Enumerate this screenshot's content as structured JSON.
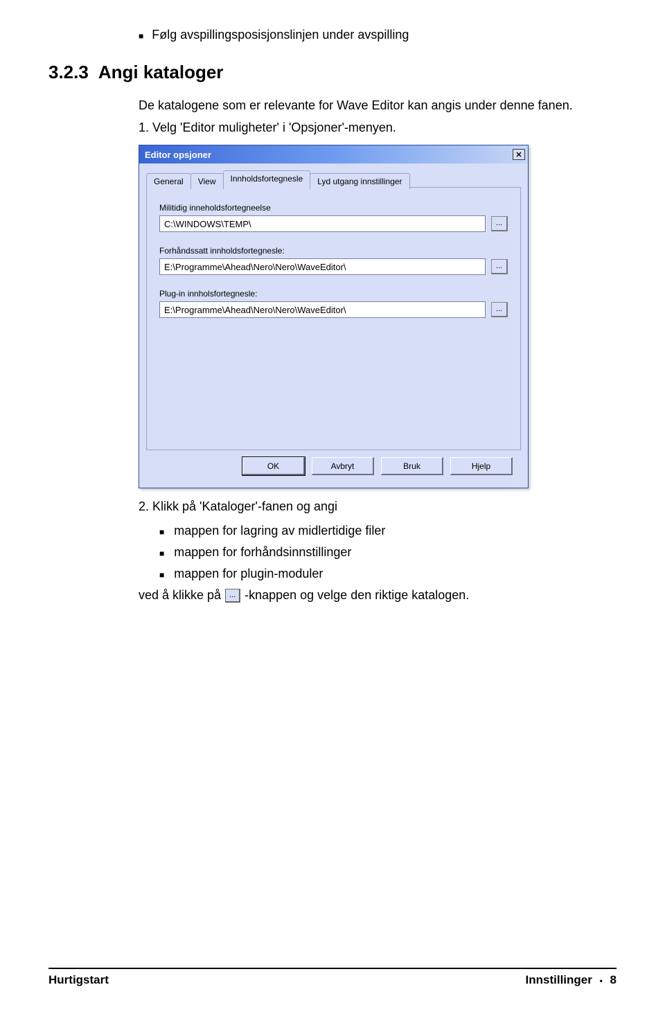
{
  "top_bullet": "Følg avspillingsposisjonslinjen under avspilling",
  "heading": {
    "number": "3.2.3",
    "title": "Angi kataloger"
  },
  "intro": "De katalogene som er relevante for Wave Editor kan angis under denne fanen.",
  "step1": "1. Velg 'Editor muligheter' i 'Opsjoner'-menyen.",
  "dialog": {
    "title": "Editor opsjoner",
    "close_icon": "close-icon",
    "tabs": {
      "general": "General",
      "view": "View",
      "innhold": "Innholdsfortegnesle",
      "lyd": "Lyd utgang innstillinger"
    },
    "fields": {
      "temp": {
        "label": "Militidig inneholdsfortegneelse",
        "value": "C:\\WINDOWS\\TEMP\\"
      },
      "preset": {
        "label": "Forhåndssatt innholdsfortegnesle:",
        "value": "E:\\Programme\\Ahead\\Nero\\Nero\\WaveEditor\\"
      },
      "plugin": {
        "label": "Plug-in innholsfortegnesle:",
        "value": "E:\\Programme\\Ahead\\Nero\\Nero\\WaveEditor\\"
      }
    },
    "browse_label": "...",
    "buttons": {
      "ok": "OK",
      "cancel": "Avbryt",
      "apply": "Bruk",
      "help": "Hjelp"
    }
  },
  "step2": "2. Klikk på 'Kataloger'-fanen og angi",
  "sub_bullets": {
    "b1": "mappen for lagring av midlertidige filer",
    "b2": "mappen for forhåndsinnstillinger",
    "b3": "mappen for plugin-moduler"
  },
  "closing_pre": "ved å klikke på",
  "closing_btn": "...",
  "closing_post": "-knappen og velge den riktige katalogen.",
  "footer": {
    "left": "Hurtigstart",
    "right_label": "Innstillinger",
    "page": "8"
  }
}
